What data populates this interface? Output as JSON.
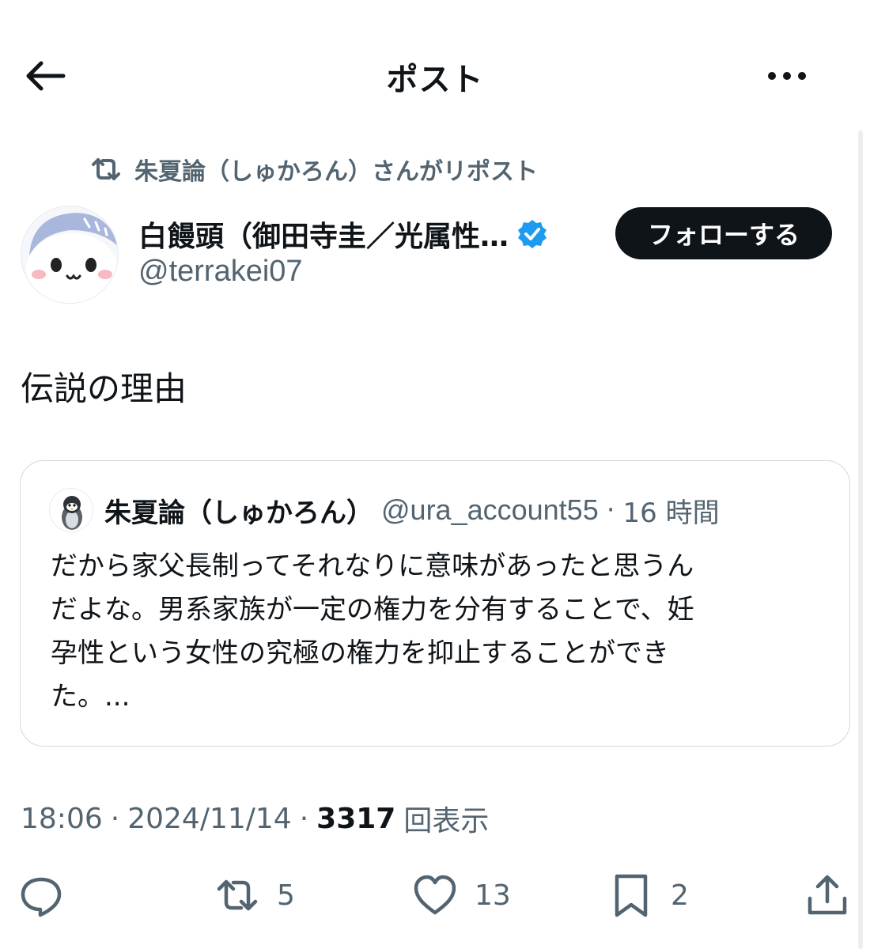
{
  "header": {
    "title": "ポスト"
  },
  "repost": {
    "text": "朱夏論（しゅかろん）さんがリポスト"
  },
  "author": {
    "name": "白饅頭（御田寺圭／光属性…",
    "handle": "@terrakei07",
    "follow_label": "フォローする"
  },
  "post": {
    "text": "伝説の理由"
  },
  "quote": {
    "name": "朱夏論（しゅかろん）",
    "handle": "@ura_account55",
    "separator": "·",
    "time": "16 時間",
    "body": "だから家父長制ってそれなりに意味があったと思うん\nだよな。男系家族が一定の権力を分有することで、妊\n孕性という女性の究極の権力を抑止することができ\nた。..."
  },
  "meta": {
    "time": "18:06",
    "sep1": "·",
    "date": "2024/11/14",
    "sep2": "·",
    "views": "3317",
    "views_label": "回表示"
  },
  "actions": {
    "reply_count": "",
    "repost_count": "5",
    "like_count": "13",
    "bookmark_count": "2"
  },
  "colors": {
    "text": "#0f1419",
    "secondary": "#536471",
    "verified": "#1d9bf0",
    "border": "#cfd9de"
  }
}
